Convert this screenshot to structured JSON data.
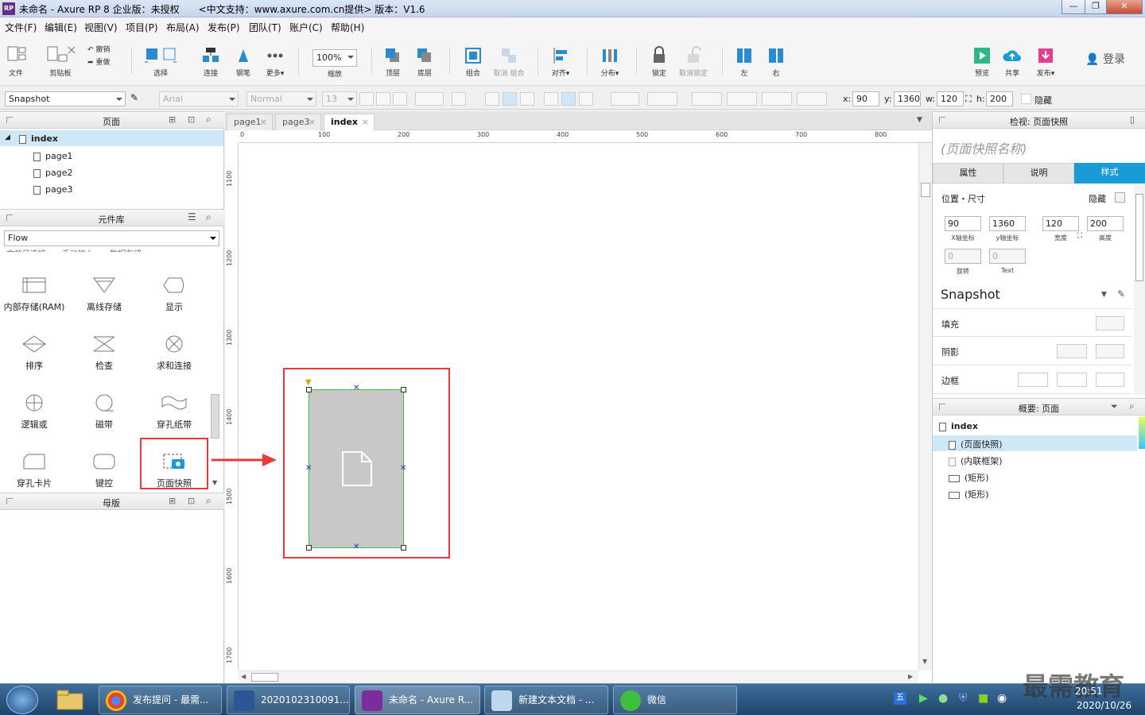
{
  "window": {
    "title": "未命名 - Axure RP 8 企业版：未授权",
    "subtitle": "<中文支持：www.axure.com.cn提供> 版本：V1.6",
    "logo": "RP",
    "controls": [
      "minimize-icon",
      "maximize-icon",
      "close-icon"
    ]
  },
  "menu": [
    "文件(F)",
    "编辑(E)",
    "视图(V)",
    "项目(P)",
    "布局(A)",
    "发布(P)",
    "团队(T)",
    "账户(C)",
    "帮助(H)"
  ],
  "toolbar": {
    "file": "文件",
    "clipboard": "剪贴板",
    "undo": "撤销",
    "redo": "重做",
    "select": "选择",
    "connect": "连接",
    "pen": "钢笔",
    "more": "更多▾",
    "zoom_value": "100%",
    "zoom_label": "缩放",
    "top": "顶层",
    "bottom": "底层",
    "group": "组合",
    "ungroup": "取消 组合",
    "align": "对齐▾",
    "distribute": "分布▾",
    "lock": "锁定",
    "unlock": "取消锁定",
    "left": "左",
    "right": "右",
    "preview": "预览",
    "share": "共享",
    "publish": "发布▾",
    "login": "登录"
  },
  "format": {
    "style": "Snapshot",
    "font": "Arial",
    "weight": "Normal",
    "size": "13",
    "x_label": "x:",
    "x": "90",
    "y_label": "y:",
    "y": "1360",
    "w_label": "w:",
    "w": "120",
    "h_label": "h:",
    "h": "200",
    "hidden": "隐藏"
  },
  "pages": {
    "title": "页面",
    "root": "index",
    "children": [
      "page1",
      "page2",
      "page3"
    ]
  },
  "library": {
    "title": "元件库",
    "selected": "Flow",
    "cut_row": "文档已连接　　手动输入　　数据存储",
    "items": [
      "内部存储(RAM)",
      "离线存储",
      "显示",
      "排序",
      "检查",
      "求和连接",
      "逻辑或",
      "磁带",
      "穿孔纸带",
      "穿孔卡片",
      "键控",
      "页面快照"
    ]
  },
  "masters": {
    "title": "母版"
  },
  "tabs": [
    "page1",
    "page3",
    "index"
  ],
  "active_tab": "index",
  "ruler": {
    "h": [
      "0",
      "100",
      "200",
      "300",
      "400",
      "500",
      "600",
      "700",
      "800"
    ],
    "v": [
      "1100",
      "1200",
      "1300",
      "1400",
      "1500",
      "1600",
      "1700"
    ]
  },
  "inspector": {
    "title": "检视: 页面快照",
    "name_placeholder": "(页面快照名称)",
    "tabs": [
      "属性",
      "说明",
      "样式"
    ],
    "active_tab": "样式",
    "pos_title": "位置・尺寸",
    "hidden": "隐藏",
    "x": "90",
    "y": "1360",
    "w": "120",
    "h": "200",
    "x_label": "X轴坐标",
    "y_label": "y轴坐标",
    "w_label": "宽度",
    "h_label": "高度",
    "rotate": "0",
    "text_rotate": "0",
    "rotate_label": "旋转",
    "text_label": "Text",
    "style_name": "Snapshot",
    "fill": "填充",
    "shadow": "阴影",
    "border": "边框"
  },
  "outline": {
    "title": "概要: 页面",
    "root": "index",
    "items": [
      "(页面快照)",
      "(内联框架)",
      "(矩形)",
      "(矩形)"
    ]
  },
  "taskbar": {
    "items": [
      "发布提问 - 最需...",
      "2020102310091...",
      "未命名 - Axure R...",
      "新建文本文档 - ...",
      "微信"
    ],
    "time": "20:51",
    "date": "2020/10/26",
    "watermark": "最需教育"
  },
  "colors": {
    "accent": "#1a9bd7",
    "highlight": "#e83a3a",
    "selection": "#cfe8f7"
  }
}
